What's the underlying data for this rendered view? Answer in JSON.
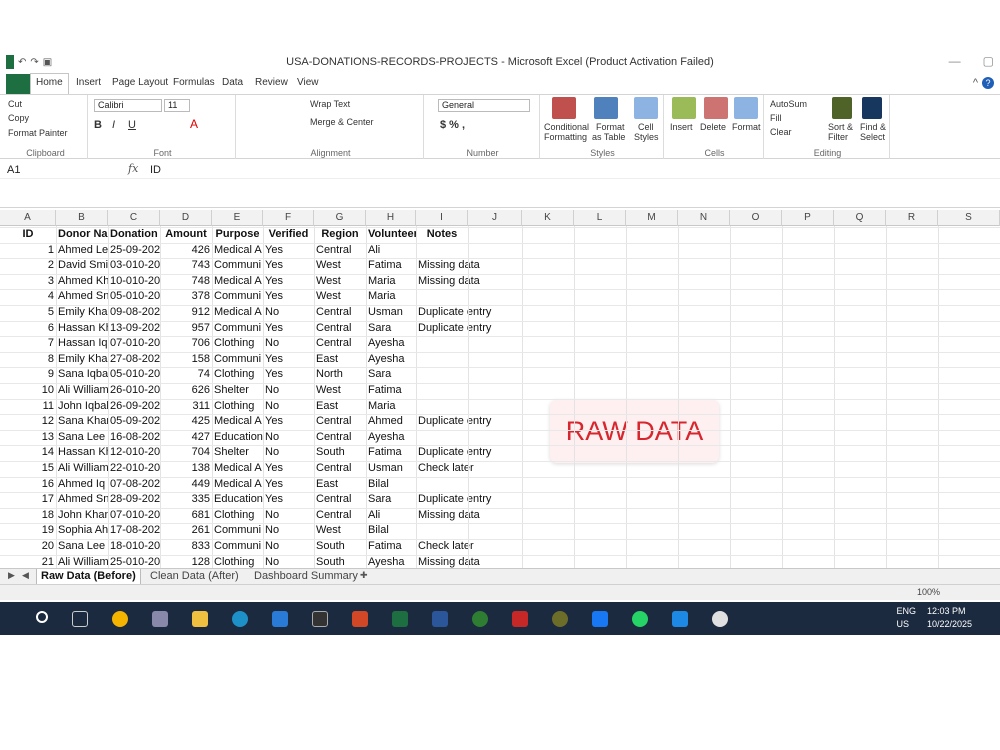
{
  "window": {
    "title": "USA-DONATIONS-RECORDS-PROJECTS  -  Microsoft Excel (Product Activation Failed)"
  },
  "ribbon_tabs": [
    "Home",
    "Insert",
    "Page Layout",
    "Formulas",
    "Data",
    "Review",
    "View"
  ],
  "ribbon": {
    "clipboard": {
      "cut": "Cut",
      "copy": "Copy",
      "format_painter": "Format Painter",
      "label": "Clipboard"
    },
    "font": {
      "name": "Calibri",
      "size": "11",
      "label": "Font"
    },
    "alignment": {
      "wrap": "Wrap Text",
      "merge": "Merge & Center",
      "label": "Alignment"
    },
    "number": {
      "format": "General",
      "label": "Number"
    },
    "styles": {
      "conditional": "Conditional",
      "conditional2": "Formatting",
      "format_table": "Format",
      "format_table2": "as Table",
      "cell_styles": "Cell",
      "cell_styles2": "Styles",
      "label": "Styles"
    },
    "cells": {
      "insert": "Insert",
      "delete": "Delete",
      "format": "Format",
      "label": "Cells"
    },
    "editing": {
      "autosum": "AutoSum",
      "fill": "Fill",
      "clear": "Clear",
      "sort": "Sort &",
      "sort2": "Filter",
      "find": "Find &",
      "find2": "Select",
      "label": "Editing"
    }
  },
  "formula_bar": {
    "name_box": "A1",
    "fx": "fx",
    "value": "ID"
  },
  "columns": [
    "A",
    "B",
    "C",
    "D",
    "E",
    "F",
    "G",
    "H",
    "I",
    "J",
    "K",
    "L",
    "M",
    "N",
    "O",
    "P",
    "Q",
    "R",
    "S"
  ],
  "headers": [
    "ID",
    "Donor Name",
    "Donation Date",
    "Amount",
    "Purpose",
    "Verified",
    "Region",
    "Volunteer",
    "Notes"
  ],
  "rows": [
    [
      "1",
      "Ahmed Le",
      "25-09-202",
      "426",
      "Medical A",
      "Yes",
      "Central",
      "Ali",
      ""
    ],
    [
      "2",
      "David Smi",
      "03-010-20",
      "743",
      "Communi",
      "Yes",
      "West",
      "Fatima",
      "Missing data"
    ],
    [
      "3",
      "Ahmed Kh",
      "10-010-20",
      "748",
      "Medical A",
      "Yes",
      "West",
      "Maria",
      "Missing data"
    ],
    [
      "4",
      "Ahmed Sn",
      "05-010-20",
      "378",
      "Communi",
      "Yes",
      "West",
      "Maria",
      ""
    ],
    [
      "5",
      "Emily Khai",
      "09-08-202",
      "912",
      "Medical A",
      "No",
      "Central",
      "Usman",
      "Duplicate entry"
    ],
    [
      "6",
      "Hassan Kh",
      "13-09-202",
      "957",
      "Communi",
      "Yes",
      "Central",
      "Sara",
      "Duplicate entry"
    ],
    [
      "7",
      "Hassan Iq",
      "07-010-20",
      "706",
      "Clothing",
      "No",
      "Central",
      "Ayesha",
      ""
    ],
    [
      "8",
      "Emily Khai",
      "27-08-202",
      "158",
      "Communi",
      "Yes",
      "East",
      "Ayesha",
      ""
    ],
    [
      "9",
      "Sana Iqba",
      "05-010-20",
      "74",
      "Clothing",
      "Yes",
      "North",
      "Sara",
      ""
    ],
    [
      "10",
      "Ali William",
      "26-010-20",
      "626",
      "Shelter",
      "No",
      "West",
      "Fatima",
      ""
    ],
    [
      "11",
      "John Iqbal",
      "26-09-202",
      "311",
      "Clothing",
      "No",
      "East",
      "Maria",
      ""
    ],
    [
      "12",
      "Sana Khan",
      "05-09-202",
      "425",
      "Medical A",
      "Yes",
      "Central",
      "Ahmed",
      "Duplicate entry"
    ],
    [
      "13",
      "Sana Lee",
      "16-08-202",
      "427",
      "Education",
      "No",
      "Central",
      "Ayesha",
      ""
    ],
    [
      "14",
      "Hassan Kh",
      "12-010-20",
      "704",
      "Shelter",
      "No",
      "South",
      "Fatima",
      "Duplicate entry"
    ],
    [
      "15",
      "Ali William",
      "22-010-20",
      "138",
      "Medical A",
      "Yes",
      "Central",
      "Usman",
      "Check later"
    ],
    [
      "16",
      "Ahmed Iq",
      "07-08-202",
      "449",
      "Medical A",
      "Yes",
      "East",
      "Bilal",
      ""
    ],
    [
      "17",
      "Ahmed Sn",
      "28-09-202",
      "335",
      "Education",
      "Yes",
      "Central",
      "Sara",
      "Duplicate entry"
    ],
    [
      "18",
      "John Khan",
      "07-010-20",
      "681",
      "Clothing",
      "No",
      "Central",
      "Ali",
      "Missing data"
    ],
    [
      "19",
      "Sophia Ah",
      "17-08-202",
      "261",
      "Communi",
      "No",
      "West",
      "Bilal",
      ""
    ],
    [
      "20",
      "Sana Lee",
      "18-010-20",
      "833",
      "Communi",
      "No",
      "South",
      "Fatima",
      "Check later"
    ],
    [
      "21",
      "Ali William",
      "25-010-20",
      "128",
      "Clothing",
      "No",
      "South",
      "Ayesha",
      "Missing data"
    ]
  ],
  "overlay_label": "RAW DATA",
  "sheet_tabs": [
    "Raw Data (Before)",
    "Clean Data (After)",
    "Dashboard Summary"
  ],
  "status": {
    "zoom": "100%"
  },
  "taskbar": {
    "lang": "ENG",
    "region": "US",
    "time": "12:03 PM",
    "date": "10/22/2025"
  }
}
